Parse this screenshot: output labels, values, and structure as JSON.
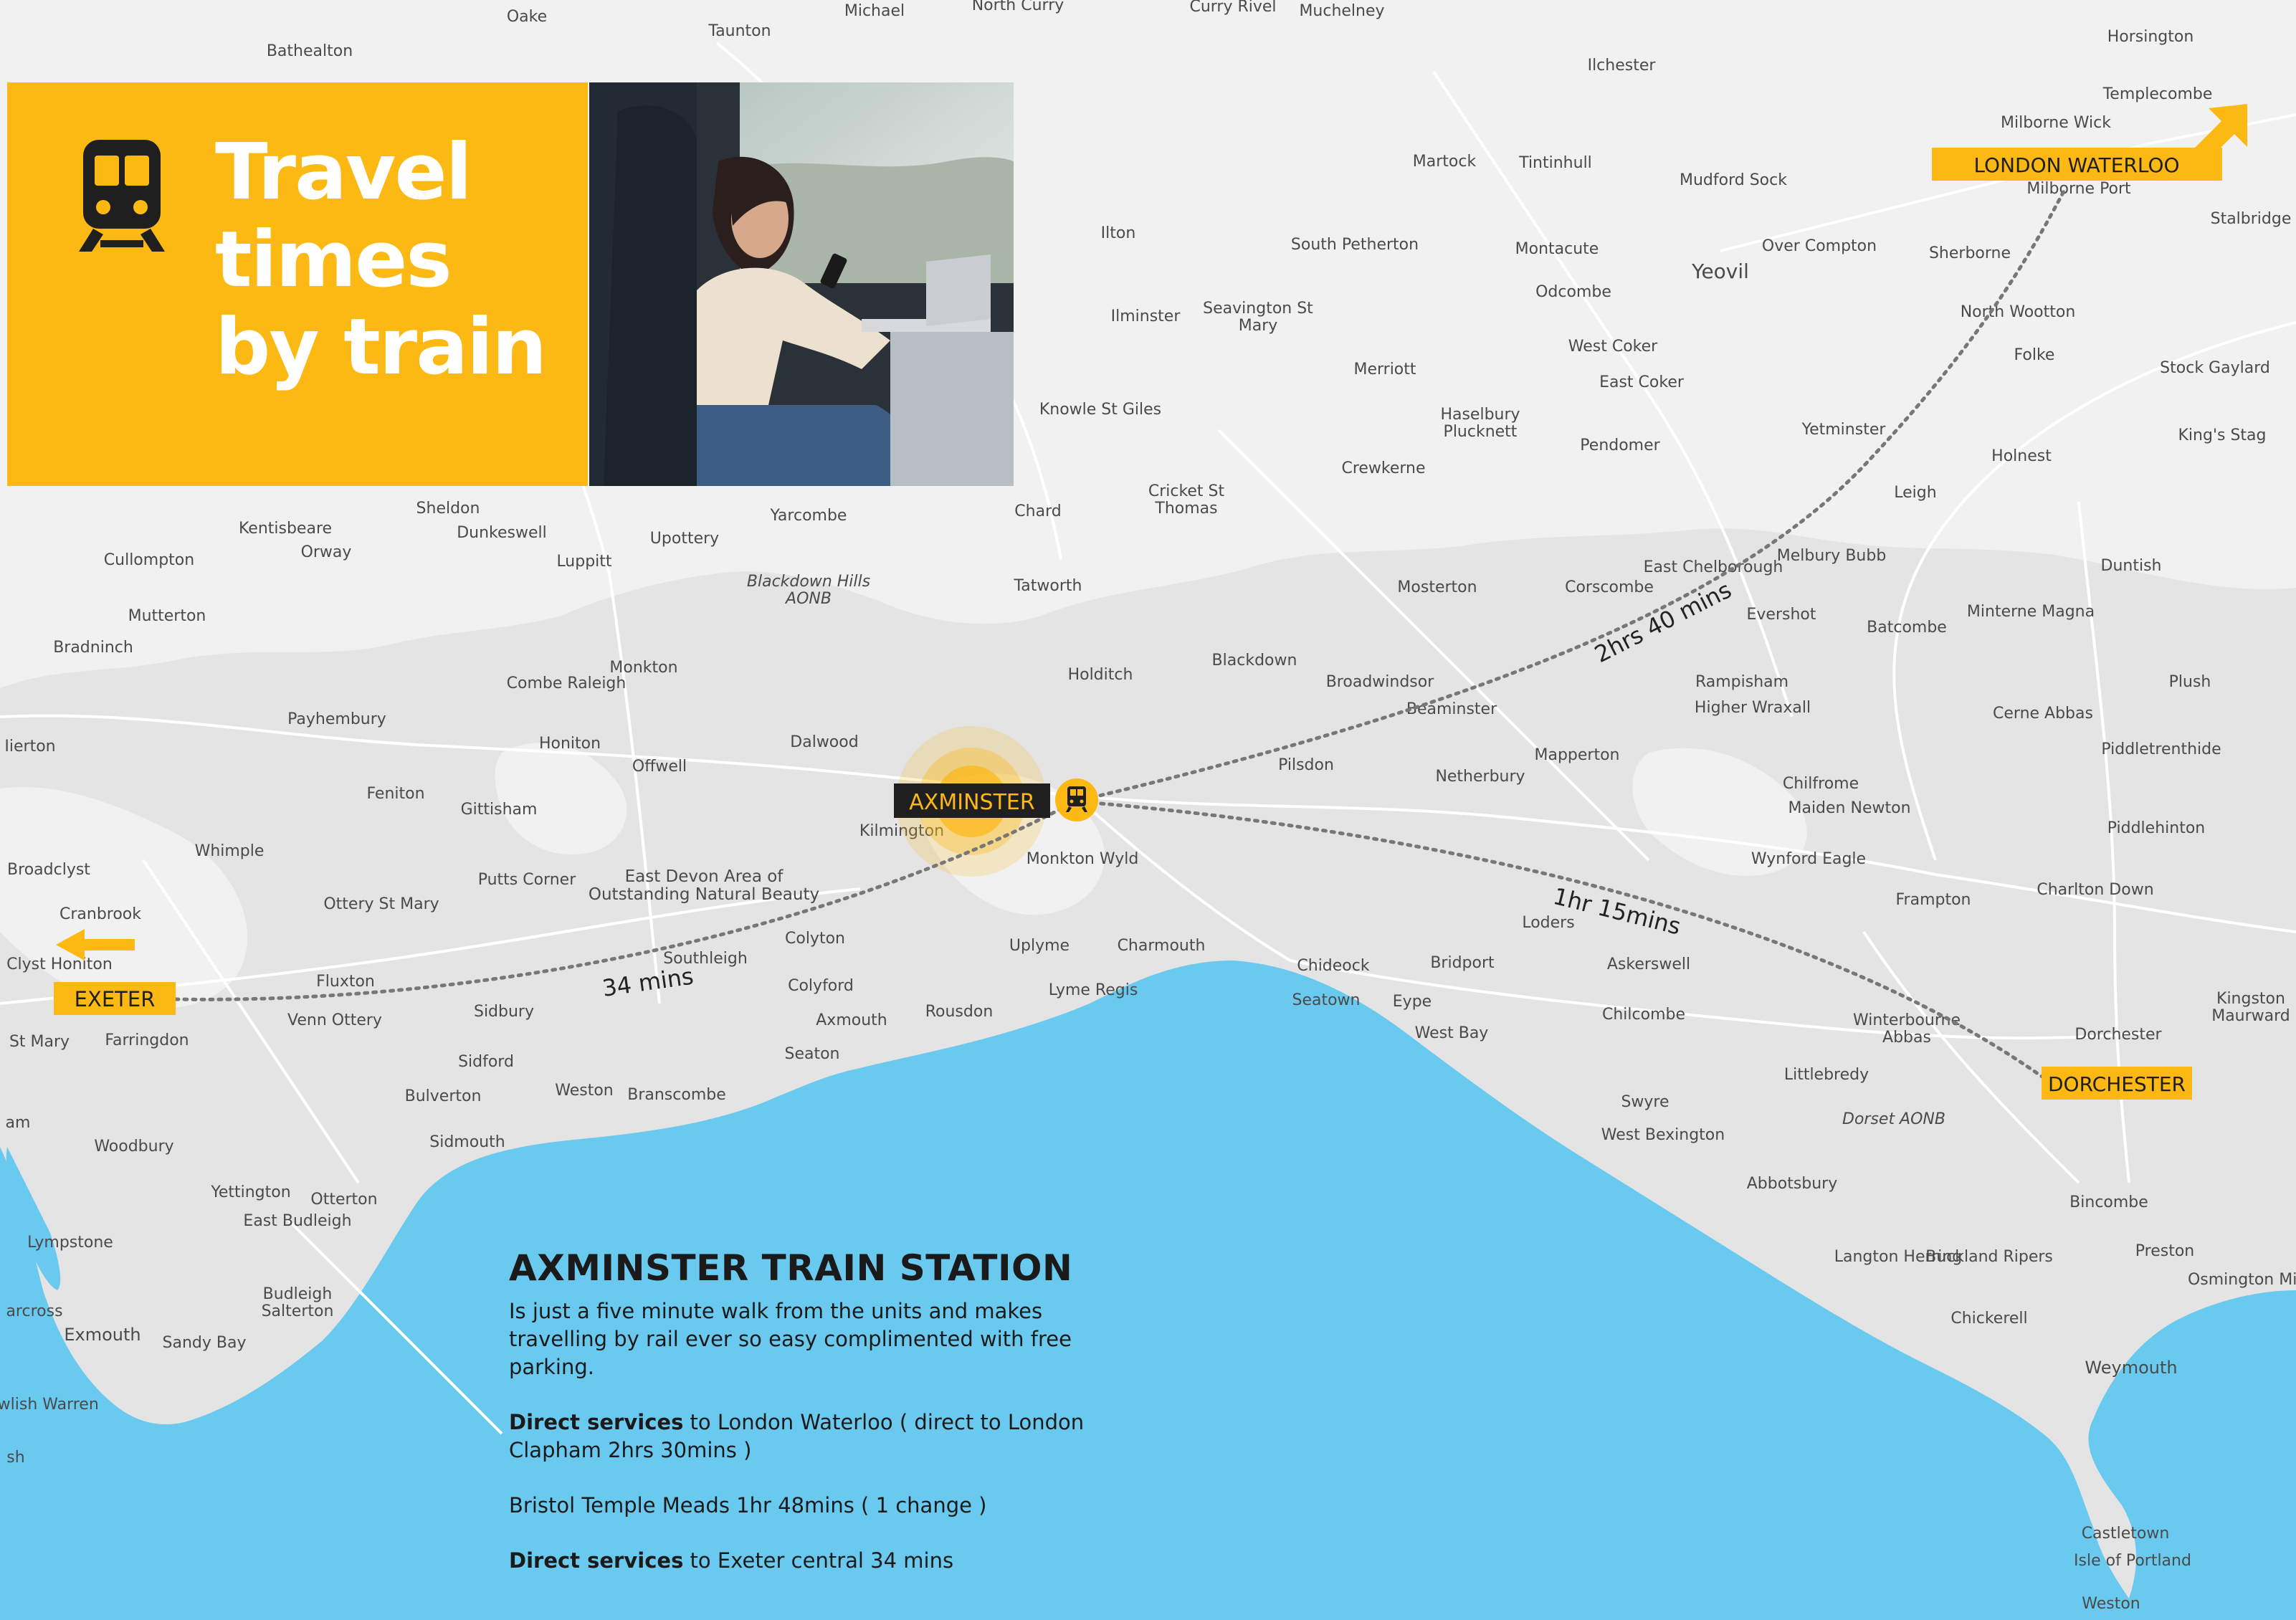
{
  "hero": {
    "title_lines": [
      "Travel",
      "times",
      "by train"
    ],
    "icon": "train-icon"
  },
  "colors": {
    "accent": "#fcb813",
    "sea": "#6ac9ef",
    "land": "#e4e4e4",
    "label_dark": "#222222"
  },
  "places": [
    {
      "id": "p1",
      "name": "Taunton"
    },
    {
      "id": "p2",
      "name": "Michael"
    },
    {
      "id": "p3",
      "name": "North Curry"
    },
    {
      "id": "p4",
      "name": "Curry Rivel"
    },
    {
      "id": "p5",
      "name": "Muchelney"
    },
    {
      "id": "p6",
      "name": "Oake"
    },
    {
      "id": "p7",
      "name": "Bathealton"
    },
    {
      "id": "p8",
      "name": "Ilchester"
    },
    {
      "id": "p9",
      "name": "Horsington"
    },
    {
      "id": "p10",
      "name": "Templecombe"
    },
    {
      "id": "p11",
      "name": "Martock"
    },
    {
      "id": "p12",
      "name": "Tintinhull"
    },
    {
      "id": "p13",
      "name": "Mudford Sock"
    },
    {
      "id": "p14",
      "name": "Milborne Wick"
    },
    {
      "id": "p15",
      "name": "Milborne Port"
    },
    {
      "id": "p16",
      "name": "Stalbridge"
    },
    {
      "id": "p17",
      "name": "Ilton"
    },
    {
      "id": "p18",
      "name": "South Petherton"
    },
    {
      "id": "p19",
      "name": "Montacute"
    },
    {
      "id": "p20",
      "name": "Yeovil"
    },
    {
      "id": "p21",
      "name": "Over Compton"
    },
    {
      "id": "p22",
      "name": "Sherborne"
    },
    {
      "id": "p23",
      "name": "Ilminster"
    },
    {
      "id": "p24",
      "name": "Seavington St Mary"
    },
    {
      "id": "p25",
      "name": "Odcombe"
    },
    {
      "id": "p26",
      "name": "North Wootton"
    },
    {
      "id": "p27",
      "name": "Folke"
    },
    {
      "id": "p28",
      "name": "West Coker"
    },
    {
      "id": "p29",
      "name": "Merriott"
    },
    {
      "id": "p30",
      "name": "East Coker"
    },
    {
      "id": "p31",
      "name": "Stock Gaylard"
    },
    {
      "id": "p32",
      "name": "Knowle St Giles"
    },
    {
      "id": "p33",
      "name": "Haselbury Plucknett"
    },
    {
      "id": "p34",
      "name": "Yetminster"
    },
    {
      "id": "p35",
      "name": "King's Stag"
    },
    {
      "id": "p36",
      "name": "Pendomer"
    },
    {
      "id": "p37",
      "name": "Holnest"
    },
    {
      "id": "p38",
      "name": "Crewkerne"
    },
    {
      "id": "p39",
      "name": "Cricket St Thomas"
    },
    {
      "id": "p40",
      "name": "Leigh"
    },
    {
      "id": "p41",
      "name": "Sheldon"
    },
    {
      "id": "p42",
      "name": "Chard"
    },
    {
      "id": "p43",
      "name": "Yarcombe"
    },
    {
      "id": "p44",
      "name": "Kentisbeare"
    },
    {
      "id": "p45",
      "name": "Dunkeswell"
    },
    {
      "id": "p46",
      "name": "Orway"
    },
    {
      "id": "p47",
      "name": "Upottery"
    },
    {
      "id": "p48",
      "name": "Melbury Bubb"
    },
    {
      "id": "p49",
      "name": "Cullompton"
    },
    {
      "id": "p50",
      "name": "Luppitt"
    },
    {
      "id": "p51",
      "name": "East Chelborough"
    },
    {
      "id": "p52",
      "name": "Duntish"
    },
    {
      "id": "p53",
      "name": "Blackdown Hills AONB"
    },
    {
      "id": "p54",
      "name": "Tatworth"
    },
    {
      "id": "p55",
      "name": "Mosterton"
    },
    {
      "id": "p56",
      "name": "Corscombe"
    },
    {
      "id": "p57",
      "name": "Evershot"
    },
    {
      "id": "p58",
      "name": "Minterne Magna"
    },
    {
      "id": "p59",
      "name": "Mutterton"
    },
    {
      "id": "p60",
      "name": "Batcombe"
    },
    {
      "id": "p61",
      "name": "Bradninch"
    },
    {
      "id": "p62",
      "name": "Blackdown"
    },
    {
      "id": "p63",
      "name": "Monkton"
    },
    {
      "id": "p64",
      "name": "Holditch"
    },
    {
      "id": "p65",
      "name": "Broadwindsor"
    },
    {
      "id": "p66",
      "name": "Rampisham"
    },
    {
      "id": "p67",
      "name": "Plush"
    },
    {
      "id": "p68",
      "name": "Combe Raleigh"
    },
    {
      "id": "p69",
      "name": "Higher Wraxall"
    },
    {
      "id": "p70",
      "name": "Payhembury"
    },
    {
      "id": "p71",
      "name": "Beaminster"
    },
    {
      "id": "p72",
      "name": "Cerne Abbas"
    },
    {
      "id": "p73",
      "name": "Dalwood"
    },
    {
      "id": "p74",
      "name": "Honiton"
    },
    {
      "id": "p75",
      "name": "Iierton"
    },
    {
      "id": "p76",
      "name": "Piddletrenthide"
    },
    {
      "id": "p77",
      "name": "Mapperton"
    },
    {
      "id": "p78",
      "name": "Offwell"
    },
    {
      "id": "p79",
      "name": "Pilsdon"
    },
    {
      "id": "p80",
      "name": "Netherbury"
    },
    {
      "id": "p81",
      "name": "Chilfrome"
    },
    {
      "id": "p82",
      "name": "Feniton"
    },
    {
      "id": "p83",
      "name": "Gittisham"
    },
    {
      "id": "p84",
      "name": "Maiden Newton"
    },
    {
      "id": "p85",
      "name": "Kilmington"
    },
    {
      "id": "p86",
      "name": "Piddlehinton"
    },
    {
      "id": "p87",
      "name": "Whimple"
    },
    {
      "id": "p88",
      "name": "Monkton Wyld"
    },
    {
      "id": "p89",
      "name": "Wynford Eagle"
    },
    {
      "id": "p90",
      "name": "Broadclyst"
    },
    {
      "id": "p91",
      "name": "East Devon Area of Outstanding Natural Beauty"
    },
    {
      "id": "p92",
      "name": "Putts Corner"
    },
    {
      "id": "p93",
      "name": "Frampton"
    },
    {
      "id": "p94",
      "name": "Charlton Down"
    },
    {
      "id": "p95",
      "name": "Ottery St Mary"
    },
    {
      "id": "p96",
      "name": "Cranbrook"
    },
    {
      "id": "p97",
      "name": "Loders"
    },
    {
      "id": "p98",
      "name": "Colyton"
    },
    {
      "id": "p99",
      "name": "Uplyme"
    },
    {
      "id": "p100",
      "name": "Charmouth"
    },
    {
      "id": "p101",
      "name": "Southleigh"
    },
    {
      "id": "p102",
      "name": "Chideock"
    },
    {
      "id": "p103",
      "name": "Bridport"
    },
    {
      "id": "p104",
      "name": "Askerswell"
    },
    {
      "id": "p105",
      "name": "Clyst Honiton"
    },
    {
      "id": "p106",
      "name": "Kingston Maurward"
    },
    {
      "id": "p107",
      "name": "Fluxton"
    },
    {
      "id": "p108",
      "name": "Colyford"
    },
    {
      "id": "p109",
      "name": "Lyme Regis"
    },
    {
      "id": "p110",
      "name": "Seatown"
    },
    {
      "id": "p111",
      "name": "Eype"
    },
    {
      "id": "p112",
      "name": "Venn Ottery"
    },
    {
      "id": "p113",
      "name": "Sidbury"
    },
    {
      "id": "p114",
      "name": "Axmouth"
    },
    {
      "id": "p115",
      "name": "Rousdon"
    },
    {
      "id": "p116",
      "name": "Chilcombe"
    },
    {
      "id": "p117",
      "name": "Winterbourne Abbas"
    },
    {
      "id": "p118",
      "name": "Farringdon"
    },
    {
      "id": "p119",
      "name": "West Bay"
    },
    {
      "id": "p120",
      "name": "Dorchester"
    },
    {
      "id": "p121",
      "name": "St Mary"
    },
    {
      "id": "p122",
      "name": "Seaton"
    },
    {
      "id": "p123",
      "name": "Sidford"
    },
    {
      "id": "p124",
      "name": "Littlebredy"
    },
    {
      "id": "p125",
      "name": "Bulverton"
    },
    {
      "id": "p126",
      "name": "Weston"
    },
    {
      "id": "p127",
      "name": "Branscombe"
    },
    {
      "id": "p128",
      "name": "Swyre"
    },
    {
      "id": "p129",
      "name": "Dorset AONB"
    },
    {
      "id": "p130",
      "name": "am"
    },
    {
      "id": "p131",
      "name": "West Bexington"
    },
    {
      "id": "p132",
      "name": "Sidmouth"
    },
    {
      "id": "p133",
      "name": "Woodbury"
    },
    {
      "id": "p134",
      "name": "Abbotsbury"
    },
    {
      "id": "p135",
      "name": "Yettington"
    },
    {
      "id": "p136",
      "name": "Otterton"
    },
    {
      "id": "p137",
      "name": "Bincombe"
    },
    {
      "id": "p138",
      "name": "East Budleigh"
    },
    {
      "id": "p139",
      "name": "Lympstone"
    },
    {
      "id": "p140",
      "name": "Preston"
    },
    {
      "id": "p141",
      "name": "Langton Herring"
    },
    {
      "id": "p142",
      "name": "Buckland Ripers"
    },
    {
      "id": "p143",
      "name": "Budleigh Salterton"
    },
    {
      "id": "p144",
      "name": "Osmington Mills"
    },
    {
      "id": "p145",
      "name": "arcross"
    },
    {
      "id": "p146",
      "name": "Chickerell"
    },
    {
      "id": "p147",
      "name": "Exmouth"
    },
    {
      "id": "p148",
      "name": "Sandy Bay"
    },
    {
      "id": "p149",
      "name": "Weymouth"
    },
    {
      "id": "p150",
      "name": "Dawlish Warren"
    },
    {
      "id": "p151",
      "name": "sh"
    },
    {
      "id": "p152",
      "name": "Castletown"
    },
    {
      "id": "p153",
      "name": "Isle of Portland"
    },
    {
      "id": "p154",
      "name": "Weston"
    }
  ],
  "stations": {
    "axminster": "AXMINSTER",
    "exeter": "EXETER",
    "dorchester": "DORCHESTER",
    "london": "LONDON WATERLOO"
  },
  "routes": {
    "exeter_time": "34 mins",
    "dorchester_time": "1hr 15mins",
    "london_time": "2hrs 40 mins"
  },
  "info": {
    "heading": "AXMINSTER TRAIN STATION",
    "description": "Is just a five minute walk from the units and makes travelling by rail ever so easy complimented with free parking.",
    "service1_bold": "Direct services",
    "service1_rest": " to London Waterloo ( direct to London Clapham 2hrs 30mins )",
    "service2": "Bristol Temple Meads 1hr 48mins ( 1 change )",
    "service3_bold": "Direct services",
    "service3_rest": " to Exeter central 34 mins"
  }
}
